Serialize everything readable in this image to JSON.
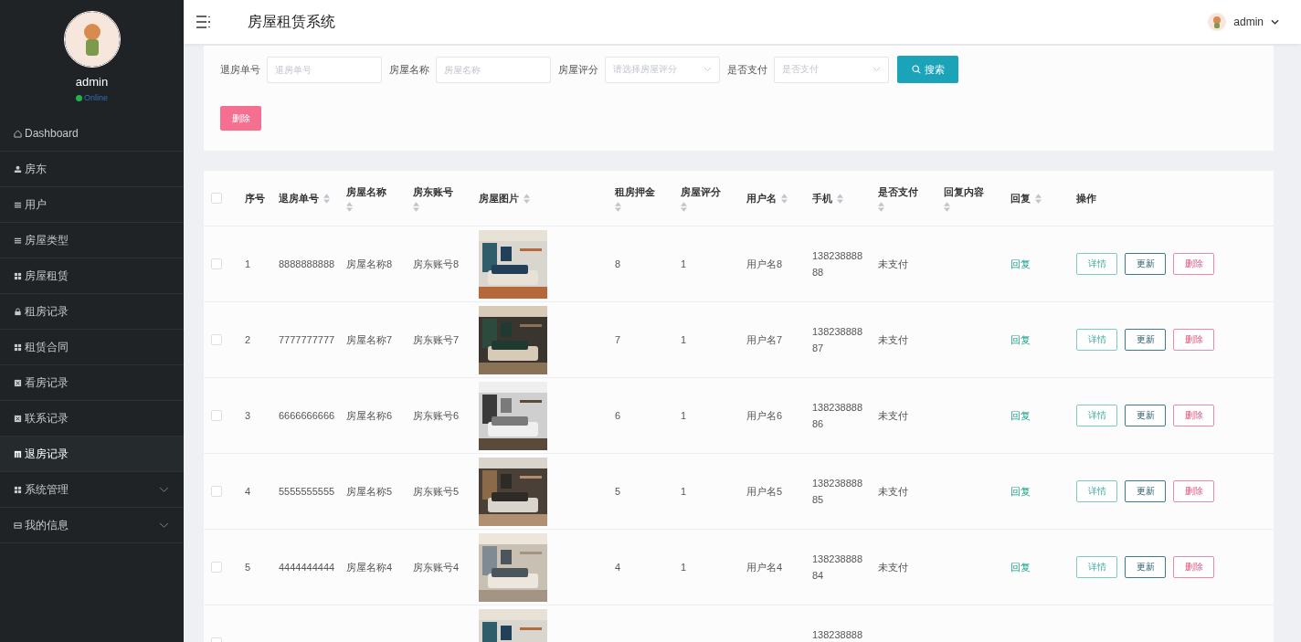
{
  "sidebar": {
    "user": {
      "name": "admin",
      "status": "Online"
    },
    "items": [
      {
        "label": "Dashboard",
        "selected": false,
        "has_children": false
      },
      {
        "label": "房东",
        "selected": false,
        "has_children": false
      },
      {
        "label": "用户",
        "selected": false,
        "has_children": false
      },
      {
        "label": "房屋类型",
        "selected": false,
        "has_children": false
      },
      {
        "label": "房屋租赁",
        "selected": false,
        "has_children": false
      },
      {
        "label": "租房记录",
        "selected": false,
        "has_children": false
      },
      {
        "label": "租赁合同",
        "selected": false,
        "has_children": false
      },
      {
        "label": "看房记录",
        "selected": false,
        "has_children": false
      },
      {
        "label": "联系记录",
        "selected": false,
        "has_children": false
      },
      {
        "label": "退房记录",
        "selected": true,
        "has_children": false
      },
      {
        "label": "系统管理",
        "selected": false,
        "has_children": true
      },
      {
        "label": "我的信息",
        "selected": false,
        "has_children": true
      }
    ]
  },
  "header": {
    "title": "房屋租赁系统",
    "user": "admin"
  },
  "search": {
    "fields": [
      {
        "label": "退房单号",
        "kind": "text",
        "placeholder": "退房单号"
      },
      {
        "label": "房屋名称",
        "kind": "text",
        "placeholder": "房屋名称"
      },
      {
        "label": "房屋评分",
        "kind": "select",
        "placeholder": "请选择房屋评分"
      },
      {
        "label": "是否支付",
        "kind": "select",
        "placeholder": "是否支付"
      }
    ],
    "search_button": "搜索",
    "delete_button": "删除"
  },
  "table": {
    "all_selected": false,
    "columns": [
      {
        "label": "序号",
        "sortable": false
      },
      {
        "label": "退房单号",
        "sortable": true
      },
      {
        "label": "房屋名称",
        "sortable": true
      },
      {
        "label": "房东账号",
        "sortable": true
      },
      {
        "label": "房屋图片",
        "sortable": true
      },
      {
        "label": "租房押金",
        "sortable": true
      },
      {
        "label": "房屋评分",
        "sortable": true
      },
      {
        "label": "用户名",
        "sortable": true
      },
      {
        "label": "手机",
        "sortable": true
      },
      {
        "label": "是否支付",
        "sortable": true
      },
      {
        "label": "回复内容",
        "sortable": true
      },
      {
        "label": "回复",
        "sortable": true
      },
      {
        "label": "操作",
        "sortable": false
      }
    ],
    "rows": [
      {
        "selected": false,
        "index": "1",
        "order_no": "8888888888",
        "house_name": "房屋名称8",
        "landlord": "房东账号8",
        "image": {
          "kind": "picture"
        },
        "deposit": "8",
        "rating": "1",
        "username": "用户名8",
        "phone": "13823888888",
        "paid": "未支付",
        "reply": "回复",
        "actions": [
          "详情",
          "更新",
          "删除"
        ]
      },
      {
        "selected": false,
        "index": "2",
        "order_no": "7777777777",
        "house_name": "房屋名称7",
        "landlord": "房东账号7",
        "image": {
          "kind": "picture"
        },
        "deposit": "7",
        "rating": "1",
        "username": "用户名7",
        "phone": "13823888887",
        "paid": "未支付",
        "reply": "回复",
        "actions": [
          "详情",
          "更新",
          "删除"
        ]
      },
      {
        "selected": false,
        "index": "3",
        "order_no": "6666666666",
        "house_name": "房屋名称6",
        "landlord": "房东账号6",
        "image": {
          "kind": "picture"
        },
        "deposit": "6",
        "rating": "1",
        "username": "用户名6",
        "phone": "13823888886",
        "paid": "未支付",
        "reply": "回复",
        "actions": [
          "详情",
          "更新",
          "删除"
        ]
      },
      {
        "selected": false,
        "index": "4",
        "order_no": "5555555555",
        "house_name": "房屋名称5",
        "landlord": "房东账号5",
        "image": {
          "kind": "picture"
        },
        "deposit": "5",
        "rating": "1",
        "username": "用户名5",
        "phone": "13823888885",
        "paid": "未支付",
        "reply": "回复",
        "actions": [
          "详情",
          "更新",
          "删除"
        ]
      },
      {
        "selected": false,
        "index": "5",
        "order_no": "4444444444",
        "house_name": "房屋名称4",
        "landlord": "房东账号4",
        "image": {
          "kind": "picture"
        },
        "deposit": "4",
        "rating": "1",
        "username": "用户名4",
        "phone": "13823888884",
        "paid": "未支付",
        "reply": "回复",
        "actions": [
          "详情",
          "更新",
          "删除"
        ]
      },
      {
        "selected": false,
        "image": {
          "kind": "picture"
        },
        "phone": "138238888"
      }
    ]
  }
}
